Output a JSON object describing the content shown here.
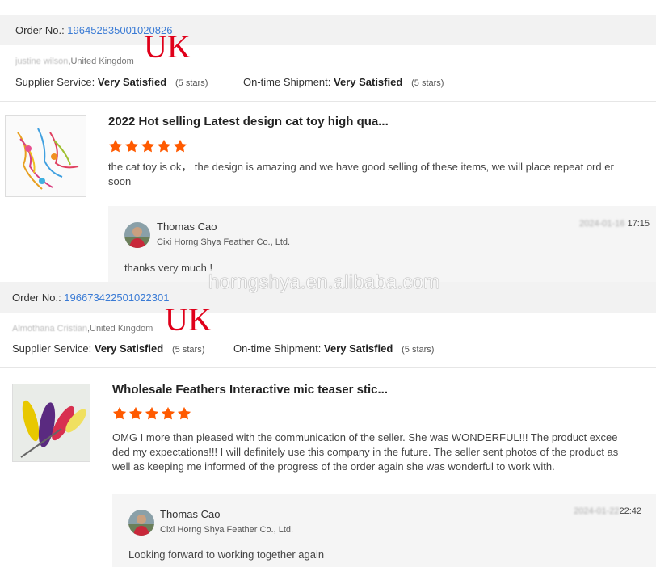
{
  "watermark": "horngshya.en.alibaba.com",
  "order_label": "Order No.: ",
  "supplier_service_label": "Supplier Service: ",
  "ontime_label": "On-time Shipment: ",
  "colors": {
    "link": "#3a7bd5",
    "star": "#ff5a00",
    "uk": "#e0001a"
  },
  "orders": [
    {
      "order_no": "196452835001020826",
      "uk_tag": "UK",
      "buyer_name": "justine wilson",
      "buyer_country": ",United Kingdom",
      "supplier_service": "Very Satisfied",
      "supplier_service_stars": "(5 stars)",
      "ontime_shipment": "Very Satisfied",
      "ontime_stars": "(5 stars)",
      "product_title": "2022 Hot selling Latest design cat toy high qua...",
      "rating": 5,
      "review_text": "the cat toy is ok， the design is amazing and we have good selling of these items,   we will place repeat ord er soon",
      "reply": {
        "name": "Thomas Cao",
        "company": "Cixi Horng Shya Feather Co., Ltd.",
        "date": "2024-01-16",
        "time": "17:15",
        "text": "thanks very much !"
      }
    },
    {
      "order_no": "196673422501022301",
      "uk_tag": "UK",
      "buyer_name": "Almothana Cristian",
      "buyer_country": ",United Kingdom",
      "supplier_service": "Very Satisfied",
      "supplier_service_stars": "(5 stars)",
      "ontime_shipment": "Very Satisfied",
      "ontime_stars": "(5 stars)",
      "product_title": "Wholesale Feathers Interactive mic teaser stic...",
      "rating": 5,
      "review_text": "OMG I more than pleased with the communication of the seller. She was WONDERFUL!!! The product excee ded my expectations!!! I will definitely use this company in the future. The seller sent photos of the product as well as keeping me informed of the progress of the order again she was wonderful to work with.",
      "reply": {
        "name": "Thomas Cao",
        "company": "Cixi Horng Shya Feather Co., Ltd.",
        "date": "2024-01-22",
        "time": "22:42",
        "text": "Looking forward to working together again"
      }
    }
  ]
}
